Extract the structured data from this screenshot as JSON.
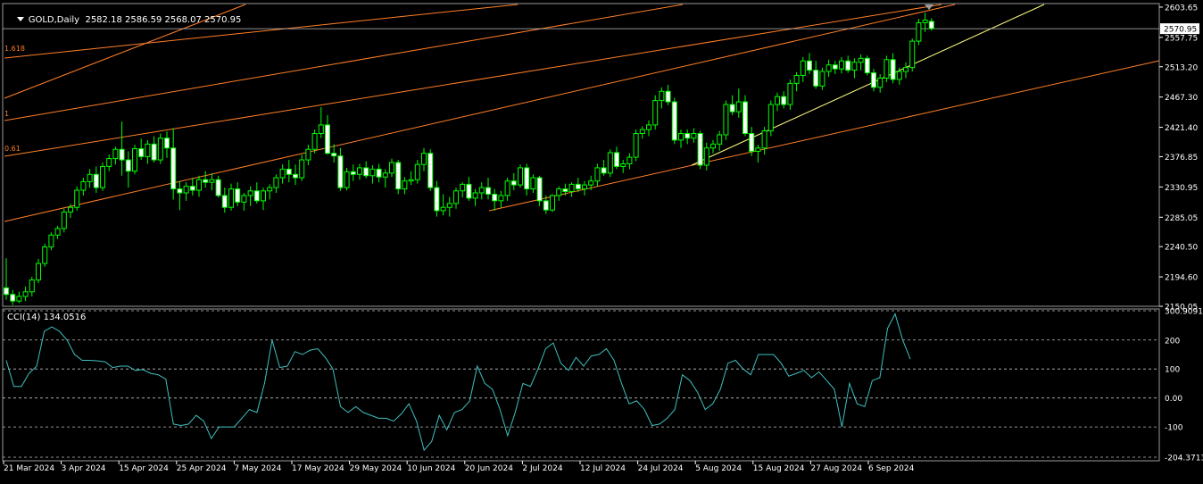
{
  "header": {
    "symbol_label": "GOLD,Daily",
    "ohlc": "2582.18 2586.59 2568.07 2570.95"
  },
  "indicator": {
    "label": "CCI(14) 134.0516"
  },
  "colors": {
    "background": "#000000",
    "bull": "#00ff00",
    "bull_body": "#000000",
    "bear_body": "#ffffff",
    "wick": "#00ff00",
    "fib": "#ff7f27",
    "trendline": "#ffff80",
    "cci_line": "#40c0c0",
    "grid": "#c0c0c0"
  },
  "chart_data": [
    {
      "type": "candlestick",
      "title": "GOLD,Daily",
      "price_scale": [
        "2603.65",
        "2557.75",
        "2513.20",
        "2467.30",
        "2421.40",
        "2376.85",
        "2330.95",
        "2285.05",
        "2240.50",
        "2194.60",
        "2150.05"
      ],
      "current_price": "2570.95",
      "ylim": [
        2150.05,
        2609.0
      ],
      "x_labels": [
        "21 Mar 2024",
        "3 Apr 2024",
        "15 Apr 2024",
        "25 Apr 2024",
        "7 May 2024",
        "17 May 2024",
        "29 May 2024",
        "10 Jun 2024",
        "20 Jun 2024",
        "2 Jul 2024",
        "12 Jul 2024",
        "24 Jul 2024",
        "5 Aug 2024",
        "15 Aug 2024",
        "27 Aug 2024",
        "6 Sep 2024"
      ],
      "fib_labels": [
        "1.618",
        "1",
        "0.61"
      ],
      "candles": [
        [
          2178,
          2223,
          2160,
          2168
        ],
        [
          2168,
          2175,
          2152,
          2158
        ],
        [
          2158,
          2172,
          2155,
          2165
        ],
        [
          2165,
          2180,
          2158,
          2172
        ],
        [
          2172,
          2195,
          2165,
          2190
        ],
        [
          2190,
          2222,
          2185,
          2215
        ],
        [
          2215,
          2245,
          2210,
          2240
        ],
        [
          2240,
          2262,
          2235,
          2258
        ],
        [
          2258,
          2272,
          2252,
          2268
        ],
        [
          2268,
          2298,
          2262,
          2293
        ],
        [
          2293,
          2305,
          2284,
          2300
        ],
        [
          2300,
          2332,
          2295,
          2326
        ],
        [
          2326,
          2345,
          2318,
          2339
        ],
        [
          2339,
          2358,
          2330,
          2350
        ],
        [
          2350,
          2362,
          2322,
          2330
        ],
        [
          2330,
          2368,
          2325,
          2362
        ],
        [
          2362,
          2380,
          2355,
          2374
        ],
        [
          2374,
          2392,
          2365,
          2388
        ],
        [
          2388,
          2430,
          2348,
          2372
        ],
        [
          2372,
          2385,
          2330,
          2355
        ],
        [
          2355,
          2395,
          2350,
          2389
        ],
        [
          2389,
          2404,
          2372,
          2377
        ],
        [
          2377,
          2402,
          2366,
          2396
        ],
        [
          2396,
          2408,
          2368,
          2372
        ],
        [
          2372,
          2412,
          2366,
          2405
        ],
        [
          2405,
          2415,
          2375,
          2390
        ],
        [
          2390,
          2420,
          2312,
          2328
        ],
        [
          2328,
          2340,
          2296,
          2322
        ],
        [
          2322,
          2338,
          2310,
          2332
        ],
        [
          2332,
          2345,
          2318,
          2326
        ],
        [
          2326,
          2348,
          2316,
          2342
        ],
        [
          2342,
          2355,
          2330,
          2338
        ],
        [
          2338,
          2352,
          2326,
          2342
        ],
        [
          2342,
          2348,
          2315,
          2318
        ],
        [
          2318,
          2330,
          2292,
          2300
        ],
        [
          2300,
          2336,
          2295,
          2328
        ],
        [
          2328,
          2338,
          2302,
          2308
        ],
        [
          2308,
          2322,
          2295,
          2318
        ],
        [
          2318,
          2332,
          2302,
          2325
        ],
        [
          2325,
          2338,
          2306,
          2310
        ],
        [
          2310,
          2330,
          2296,
          2325
        ],
        [
          2325,
          2335,
          2312,
          2330
        ],
        [
          2330,
          2350,
          2322,
          2345
        ],
        [
          2345,
          2365,
          2336,
          2358
        ],
        [
          2358,
          2372,
          2338,
          2350
        ],
        [
          2350,
          2365,
          2334,
          2345
        ],
        [
          2345,
          2380,
          2340,
          2372
        ],
        [
          2372,
          2395,
          2364,
          2388
        ],
        [
          2388,
          2418,
          2382,
          2412
        ],
        [
          2412,
          2452,
          2405,
          2425
        ],
        [
          2425,
          2440,
          2380,
          2382
        ],
        [
          2382,
          2396,
          2368,
          2378
        ],
        [
          2378,
          2390,
          2325,
          2330
        ],
        [
          2330,
          2360,
          2326,
          2354
        ],
        [
          2354,
          2365,
          2340,
          2350
        ],
        [
          2350,
          2366,
          2342,
          2360
        ],
        [
          2360,
          2370,
          2344,
          2348
        ],
        [
          2348,
          2364,
          2336,
          2358
        ],
        [
          2358,
          2366,
          2338,
          2346
        ],
        [
          2346,
          2358,
          2330,
          2352
        ],
        [
          2352,
          2374,
          2346,
          2368
        ],
        [
          2368,
          2372,
          2320,
          2328
        ],
        [
          2328,
          2346,
          2320,
          2340
        ],
        [
          2340,
          2355,
          2334,
          2342
        ],
        [
          2342,
          2372,
          2336,
          2365
        ],
        [
          2365,
          2390,
          2355,
          2382
        ],
        [
          2382,
          2388,
          2325,
          2330
        ],
        [
          2330,
          2340,
          2286,
          2295
        ],
        [
          2295,
          2320,
          2288,
          2300
        ],
        [
          2300,
          2316,
          2286,
          2306
        ],
        [
          2306,
          2330,
          2298,
          2325
        ],
        [
          2325,
          2338,
          2315,
          2335
        ],
        [
          2335,
          2346,
          2310,
          2314
        ],
        [
          2314,
          2328,
          2302,
          2322
        ],
        [
          2322,
          2338,
          2312,
          2330
        ],
        [
          2330,
          2345,
          2312,
          2320
        ],
        [
          2320,
          2328,
          2295,
          2310
        ],
        [
          2310,
          2325,
          2300,
          2318
        ],
        [
          2318,
          2345,
          2310,
          2340
        ],
        [
          2340,
          2352,
          2326,
          2334
        ],
        [
          2334,
          2365,
          2330,
          2360
        ],
        [
          2360,
          2366,
          2318,
          2328
        ],
        [
          2328,
          2350,
          2322,
          2345
        ],
        [
          2345,
          2348,
          2302,
          2310
        ],
        [
          2310,
          2318,
          2290,
          2296
        ],
        [
          2296,
          2320,
          2293,
          2318
        ],
        [
          2318,
          2332,
          2310,
          2328
        ],
        [
          2328,
          2336,
          2318,
          2324
        ],
        [
          2324,
          2338,
          2316,
          2335
        ],
        [
          2335,
          2345,
          2323,
          2328
        ],
        [
          2328,
          2340,
          2318,
          2334
        ],
        [
          2334,
          2348,
          2326,
          2340
        ],
        [
          2340,
          2366,
          2332,
          2360
        ],
        [
          2360,
          2372,
          2348,
          2352
        ],
        [
          2352,
          2388,
          2346,
          2383
        ],
        [
          2383,
          2392,
          2358,
          2362
        ],
        [
          2362,
          2372,
          2352,
          2366
        ],
        [
          2366,
          2382,
          2358,
          2376
        ],
        [
          2376,
          2418,
          2370,
          2412
        ],
        [
          2412,
          2423,
          2404,
          2418
        ],
        [
          2418,
          2432,
          2408,
          2425
        ],
        [
          2425,
          2470,
          2418,
          2462
        ],
        [
          2462,
          2482,
          2450,
          2476
        ],
        [
          2476,
          2486,
          2455,
          2460
        ],
        [
          2460,
          2466,
          2396,
          2402
        ],
        [
          2402,
          2418,
          2390,
          2412
        ],
        [
          2412,
          2418,
          2396,
          2405
        ],
        [
          2405,
          2420,
          2398,
          2412
        ],
        [
          2412,
          2416,
          2358,
          2364
        ],
        [
          2364,
          2398,
          2356,
          2390
        ],
        [
          2390,
          2402,
          2382,
          2396
        ],
        [
          2396,
          2416,
          2386,
          2410
        ],
        [
          2410,
          2462,
          2402,
          2456
        ],
        [
          2456,
          2470,
          2440,
          2445
        ],
        [
          2445,
          2480,
          2436,
          2460
        ],
        [
          2460,
          2470,
          2408,
          2412
        ],
        [
          2412,
          2422,
          2378,
          2385
        ],
        [
          2385,
          2395,
          2368,
          2390
        ],
        [
          2390,
          2422,
          2380,
          2416
        ],
        [
          2416,
          2462,
          2408,
          2456
        ],
        [
          2456,
          2474,
          2446,
          2468
        ],
        [
          2468,
          2476,
          2450,
          2456
        ],
        [
          2456,
          2494,
          2448,
          2488
        ],
        [
          2488,
          2505,
          2476,
          2500
        ],
        [
          2500,
          2528,
          2490,
          2522
        ],
        [
          2522,
          2534,
          2502,
          2508
        ],
        [
          2508,
          2522,
          2480,
          2484
        ],
        [
          2484,
          2512,
          2478,
          2506
        ],
        [
          2506,
          2524,
          2498,
          2516
        ],
        [
          2516,
          2522,
          2502,
          2510
        ],
        [
          2510,
          2528,
          2503,
          2522
        ],
        [
          2522,
          2530,
          2504,
          2508
        ],
        [
          2508,
          2526,
          2496,
          2520
        ],
        [
          2520,
          2532,
          2508,
          2526
        ],
        [
          2526,
          2530,
          2500,
          2504
        ],
        [
          2504,
          2510,
          2476,
          2482
        ],
        [
          2482,
          2502,
          2474,
          2496
        ],
        [
          2496,
          2530,
          2490,
          2524
        ],
        [
          2524,
          2534,
          2488,
          2494
        ],
        [
          2494,
          2512,
          2486,
          2506
        ],
        [
          2506,
          2520,
          2496,
          2512
        ],
        [
          2512,
          2556,
          2506,
          2552
        ],
        [
          2552,
          2586,
          2546,
          2580
        ],
        [
          2580,
          2595,
          2566,
          2584
        ],
        [
          2582,
          2587,
          2568,
          2571
        ]
      ]
    },
    {
      "type": "line",
      "title": "CCI(14) 134.0516",
      "scale_labels": [
        "300.9091",
        "200",
        "100",
        "0.00",
        "-100",
        "-204.3713"
      ],
      "levels": [
        200,
        100,
        0,
        -100
      ],
      "ylim": [
        -204.3713,
        300.9091
      ],
      "values": [
        130,
        40,
        40,
        85,
        110,
        230,
        245,
        230,
        200,
        150,
        130,
        130,
        128,
        125,
        105,
        110,
        110,
        95,
        98,
        85,
        80,
        65,
        -90,
        -95,
        -90,
        -60,
        -80,
        -140,
        -100,
        -100,
        -100,
        -70,
        -40,
        -50,
        50,
        200,
        105,
        110,
        160,
        150,
        165,
        170,
        140,
        100,
        -30,
        -50,
        -30,
        -50,
        -60,
        -70,
        -70,
        -80,
        -55,
        -20,
        -80,
        -180,
        -150,
        -60,
        -110,
        -50,
        -40,
        -10,
        110,
        50,
        30,
        -40,
        -130,
        -50,
        50,
        40,
        100,
        170,
        190,
        120,
        95,
        140,
        110,
        145,
        150,
        170,
        130,
        50,
        -20,
        -10,
        -40,
        -95,
        -90,
        -70,
        -40,
        80,
        60,
        20,
        -40,
        -20,
        30,
        120,
        130,
        100,
        80,
        150,
        150,
        150,
        120,
        75,
        85,
        95,
        70,
        90,
        60,
        30,
        -100,
        50,
        -20,
        -30,
        60,
        70,
        240,
        290,
        200,
        134
      ]
    }
  ]
}
